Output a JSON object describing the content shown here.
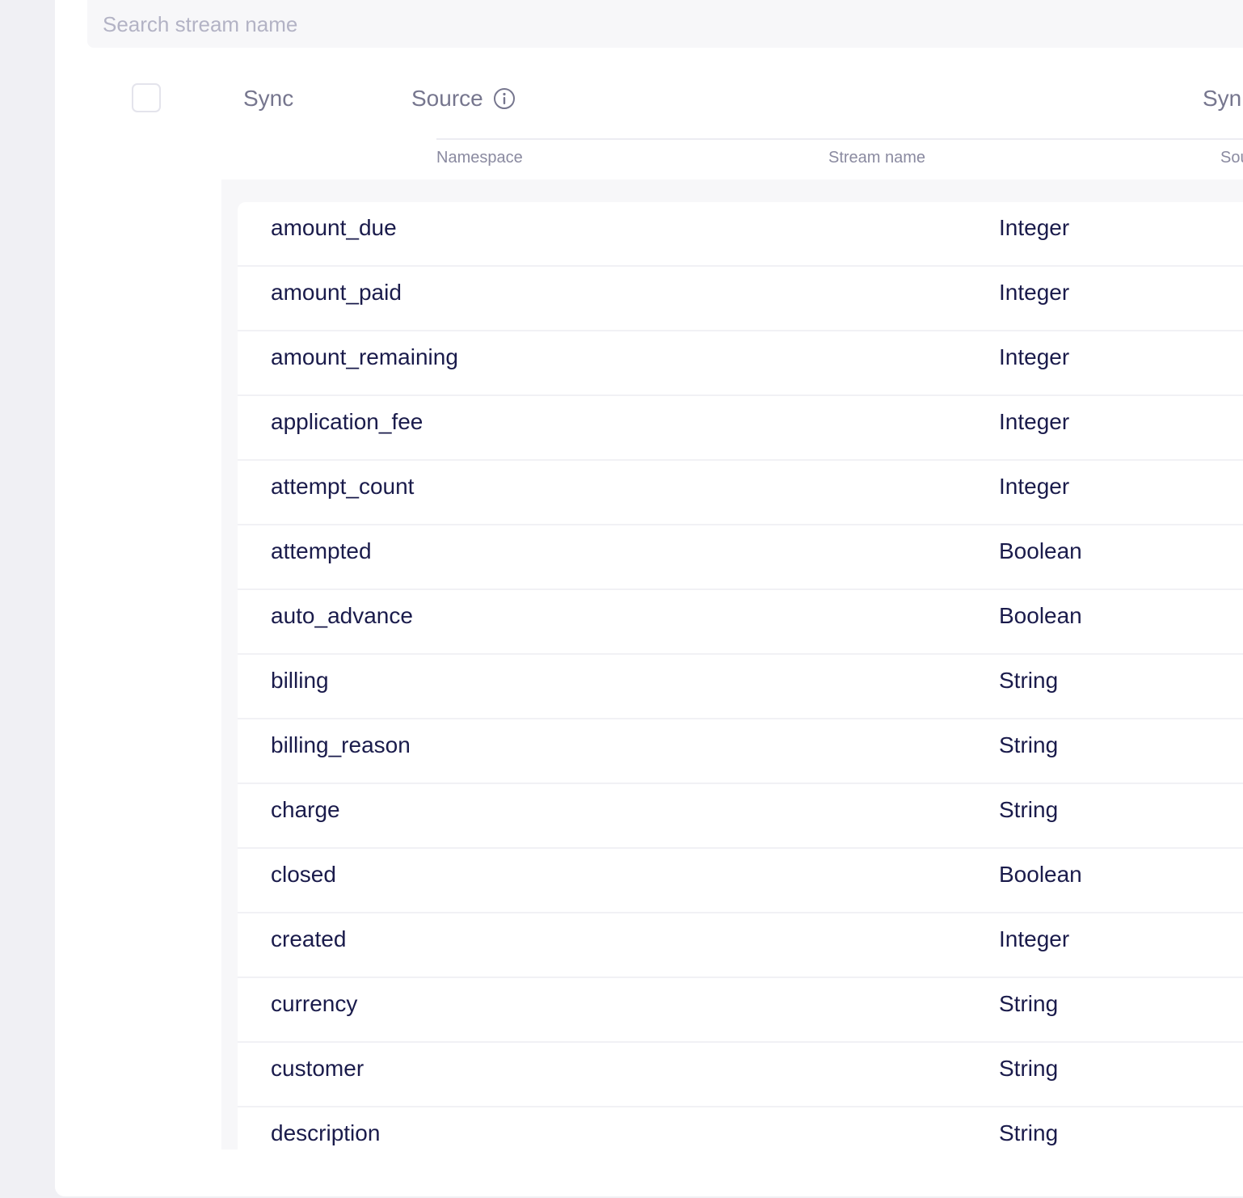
{
  "search": {
    "placeholder": "Search stream name",
    "value": ""
  },
  "header": {
    "sync_label": "Sync",
    "source_label": "Source",
    "sync_mode_label_partial": "Syn"
  },
  "subheader": {
    "namespace": "Namespace",
    "stream_name": "Stream name",
    "source_field_partial": "Sou"
  },
  "fields": [
    {
      "name": "amount_due",
      "type": "Integer"
    },
    {
      "name": "amount_paid",
      "type": "Integer"
    },
    {
      "name": "amount_remaining",
      "type": "Integer"
    },
    {
      "name": "application_fee",
      "type": "Integer"
    },
    {
      "name": "attempt_count",
      "type": "Integer"
    },
    {
      "name": "attempted",
      "type": "Boolean"
    },
    {
      "name": "auto_advance",
      "type": "Boolean"
    },
    {
      "name": "billing",
      "type": "String"
    },
    {
      "name": "billing_reason",
      "type": "String"
    },
    {
      "name": "charge",
      "type": "String"
    },
    {
      "name": "closed",
      "type": "Boolean"
    },
    {
      "name": "created",
      "type": "Integer"
    },
    {
      "name": "currency",
      "type": "String"
    },
    {
      "name": "customer",
      "type": "String"
    },
    {
      "name": "description",
      "type": "String"
    }
  ],
  "icons": {
    "source_info": "info-circle-icon"
  },
  "colors": {
    "text_primary": "#1a1b4b",
    "text_muted": "#76768e",
    "background": "#f0f0f4",
    "panel": "#f7f7f9"
  }
}
